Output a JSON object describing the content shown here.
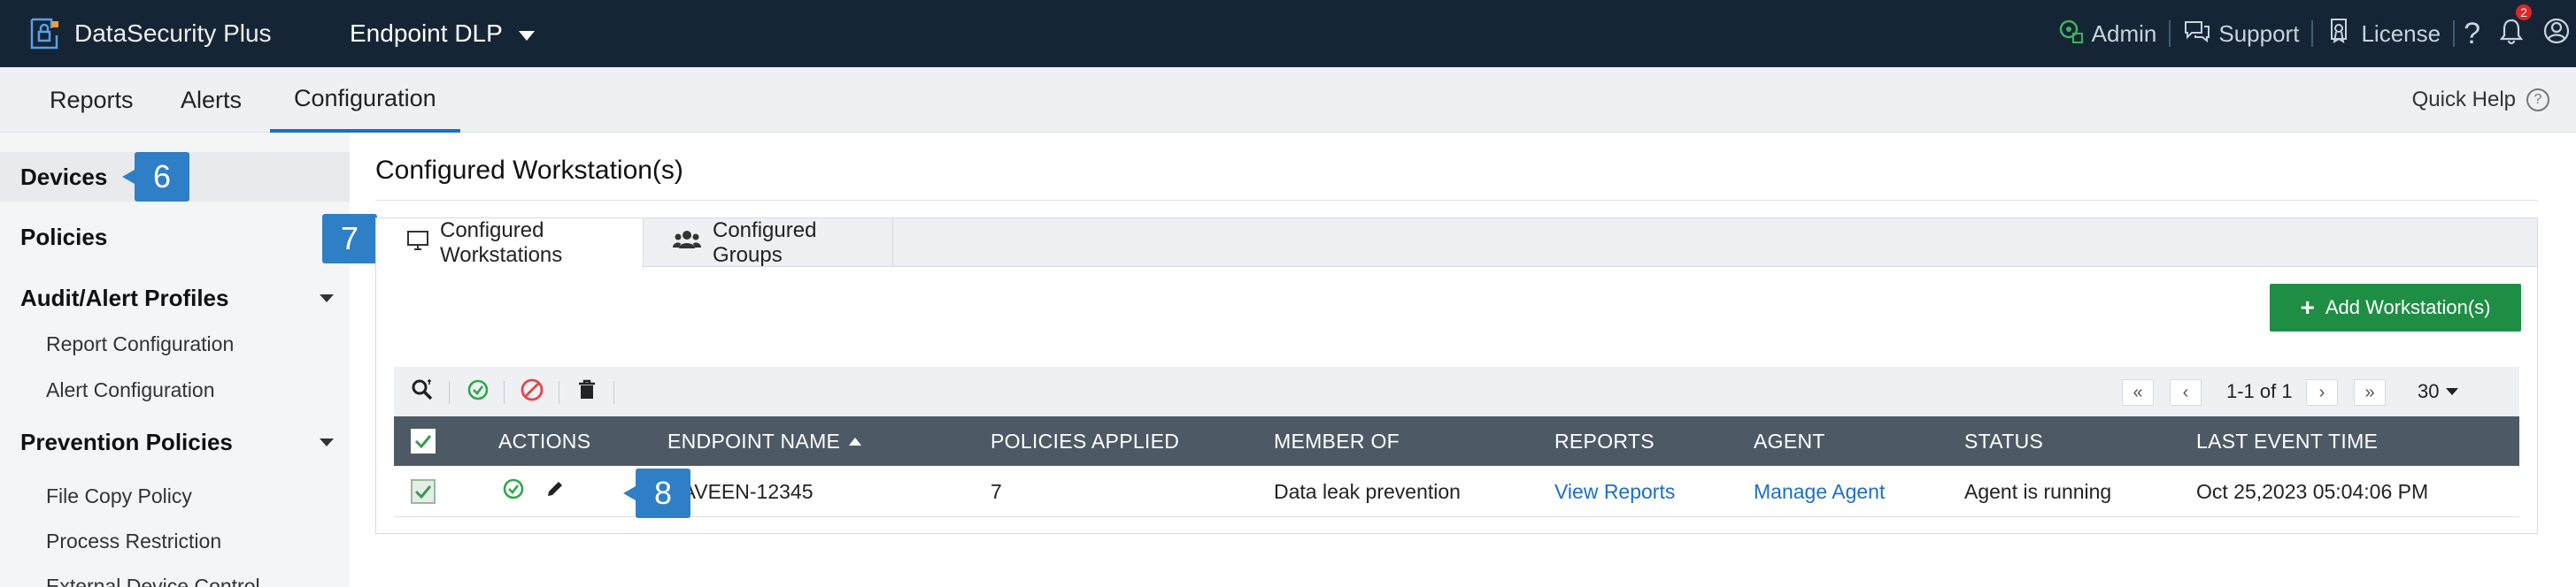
{
  "topbar": {
    "brand": "DataSecurity Plus",
    "product": "Endpoint DLP",
    "admin": "Admin",
    "support": "Support",
    "license": "License",
    "notification_count": "2"
  },
  "nav": {
    "tabs": [
      "Reports",
      "Alerts",
      "Configuration"
    ],
    "active_tab": "Configuration",
    "quick_help": "Quick Help"
  },
  "sidebar": {
    "devices": "Devices",
    "policies": "Policies",
    "audit_alert_profiles": "Audit/Alert Profiles",
    "report_configuration": "Report Configuration",
    "alert_configuration": "Alert Configuration",
    "prevention_policies": "Prevention Policies",
    "file_copy_policy": "File Copy Policy",
    "process_restriction": "Process Restriction",
    "external_device_control": "External Device Control"
  },
  "callouts": {
    "devices": "6",
    "tab": "7",
    "row_action": "8"
  },
  "main": {
    "title": "Configured Workstation(s)",
    "tabs": [
      "Configured Workstations",
      "Configured Groups"
    ],
    "add_button": "Add Workstation(s)"
  },
  "pager": {
    "range": "1-1 of 1",
    "page_size": "30"
  },
  "table": {
    "headers": {
      "actions": "ACTIONS",
      "endpoint_name": "ENDPOINT NAME",
      "policies_applied": "POLICIES APPLIED",
      "member_of": "MEMBER OF",
      "reports": "REPORTS",
      "agent": "AGENT",
      "status": "STATUS",
      "last_event_time": "LAST EVENT TIME"
    },
    "rows": [
      {
        "endpoint_name": "NAVEEN-12345",
        "policies_applied": "7",
        "member_of": "Data leak prevention",
        "reports": "View Reports",
        "agent": "Manage Agent",
        "status": "Agent is running",
        "last_event_time": "Oct 25,2023 05:04:06 PM"
      }
    ]
  },
  "colors": {
    "topbar_bg": "#152535",
    "accent_blue": "#1b6fc7",
    "callout_blue": "#2f7fc6",
    "add_button_green": "#1e8e45",
    "table_header_bg": "#4d5a66",
    "enable_green": "#2ea84a",
    "disable_red": "#e04848"
  }
}
